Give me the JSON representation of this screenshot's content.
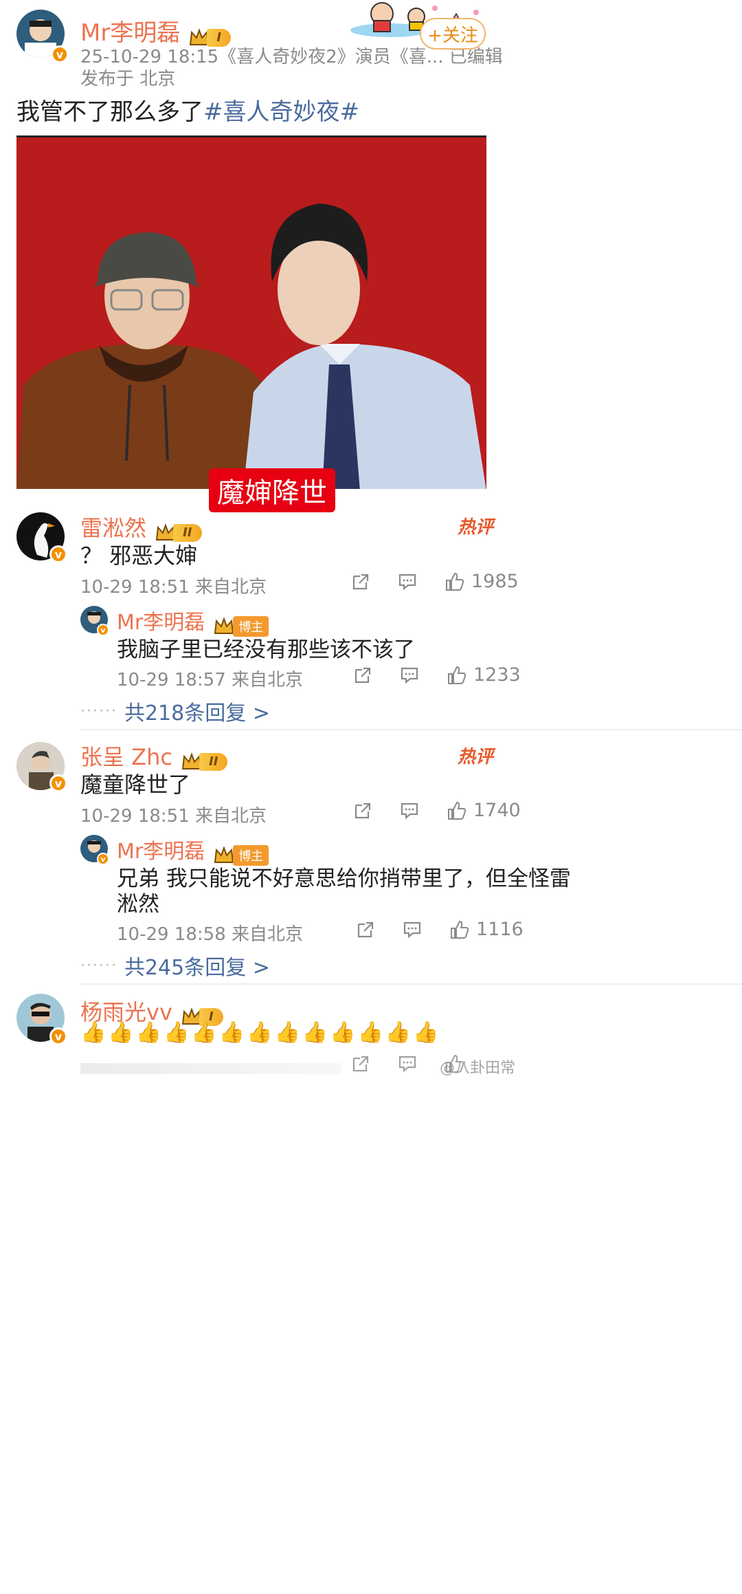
{
  "post": {
    "author": "Mr李明磊",
    "level": "I",
    "meta_line": "25-10-29 18:15《喜人奇妙夜2》演员《喜...  已编辑",
    "location": "发布于 北京",
    "follow_label": "+关注",
    "text_plain": "我管不了那么多了",
    "hashtag": "#喜人奇妙夜#",
    "image_caption": "魔婶降世"
  },
  "comments": [
    {
      "name": "雷淞然",
      "level": "II",
      "hot_label": "热评",
      "text": "？ 邪恶大婶",
      "time": "10-29 18:51 来自北京",
      "likes": "1985",
      "reply": {
        "name": "Mr李明磊",
        "tag": "博主",
        "text": "我脑子里已经没有那些该不该了",
        "time": "10-29 18:57 来自北京",
        "likes": "1233"
      },
      "more_replies": "共218条回复 >"
    },
    {
      "name": "张呈 Zhc",
      "level": "II",
      "hot_label": "热评",
      "text": "魔童降世了",
      "time": "10-29 18:51 来自北京",
      "likes": "1740",
      "reply": {
        "name": "Mr李明磊",
        "tag": "博主",
        "text_line1": "兄弟 我只能说不好意思给你捎带里了，但全怪雷",
        "text_line2": "淞然",
        "time": "10-29 18:58 来自北京",
        "likes": "1116"
      },
      "more_replies": "共245条回复 >"
    },
    {
      "name": "杨雨光vv",
      "level": "I",
      "emoji_row": "👍👍👍👍👍👍👍👍👍👍👍👍👍"
    }
  ],
  "watermark": "@八卦田常",
  "colors": {
    "name_orange": "#eb7350",
    "link_blue": "#4a6b9e",
    "photo_bg": "#b81c1c",
    "caption_red": "#e60012"
  }
}
